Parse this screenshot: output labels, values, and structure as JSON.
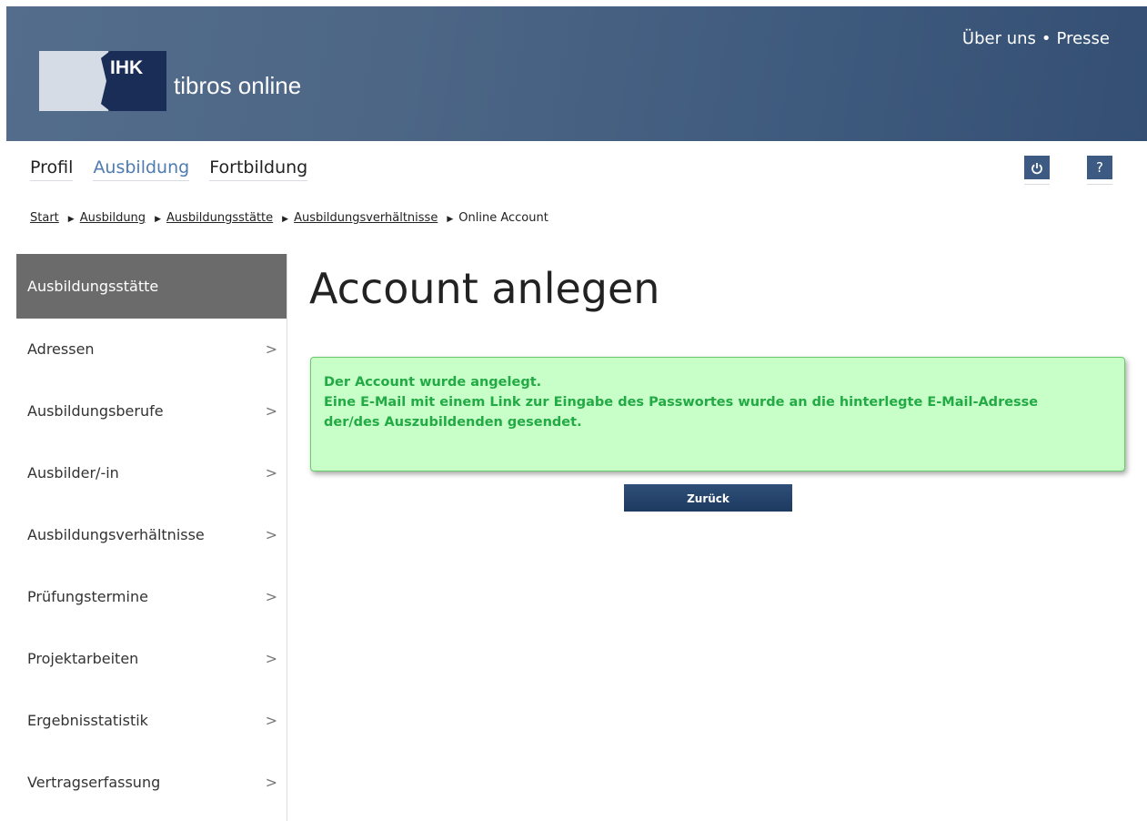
{
  "header": {
    "logo_abbr": "IHK",
    "app_name": "tibros online",
    "links": [
      "Über uns",
      "Presse"
    ],
    "link_separator": "•"
  },
  "mainnav": {
    "items": [
      {
        "label": "Profil",
        "active": false
      },
      {
        "label": "Ausbildung",
        "active": true
      },
      {
        "label": "Fortbildung",
        "active": false
      }
    ]
  },
  "icons": {
    "power": "power-icon",
    "help": "?"
  },
  "breadcrumb": {
    "items": [
      "Start",
      "Ausbildung",
      "Ausbildungsstätte",
      "Ausbildungsverhältnisse"
    ],
    "current": "Online Account"
  },
  "sidebar": {
    "heading": "Ausbildungsstätte",
    "items": [
      {
        "label": "Adressen"
      },
      {
        "label": "Ausbildungsberufe"
      },
      {
        "label": "Ausbilder/-in"
      },
      {
        "label": "Ausbildungsverhältnisse"
      },
      {
        "label": "Prüfungstermine"
      },
      {
        "label": "Projektarbeiten"
      },
      {
        "label": "Ergebnisstatistik"
      },
      {
        "label": "Vertragserfassung"
      }
    ]
  },
  "main": {
    "title": "Account anlegen",
    "message_lines": [
      "Der Account wurde angelegt.",
      "Eine E-Mail mit einem Link zur Eingabe des Passwortes wurde an die hinterlegte E-Mail-Adresse",
      "der/des Auszubildenden gesendet."
    ],
    "back_button": "Zurück"
  },
  "colors": {
    "header": "#3e5a7d",
    "accent": "#4e7bb1",
    "success_bg": "#c8ffc8",
    "success_text": "#22aa44",
    "sidebar_head": "#6b6b6b"
  }
}
